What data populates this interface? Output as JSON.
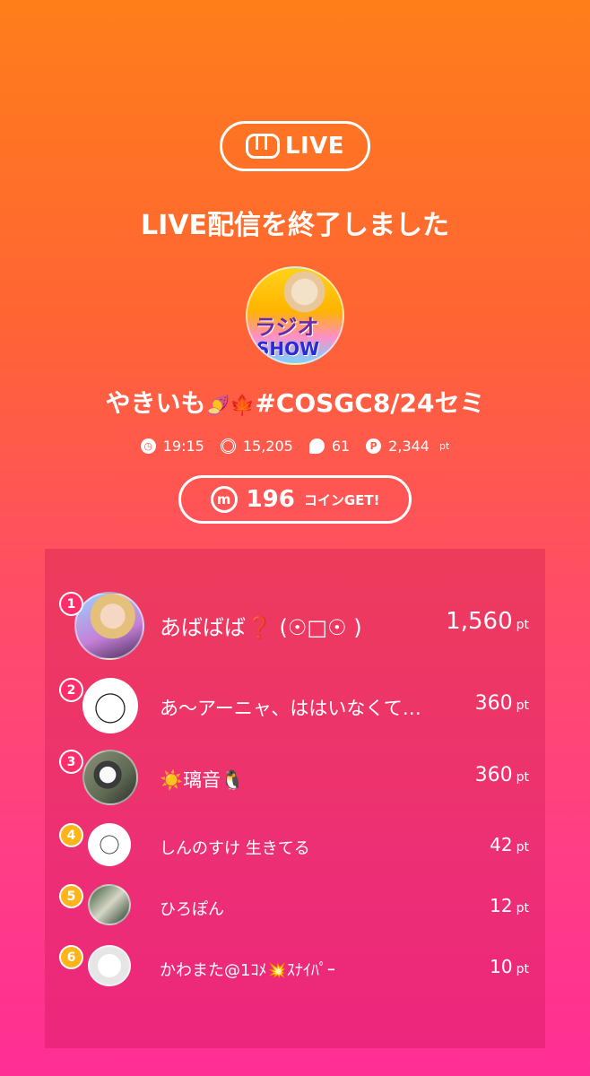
{
  "header": {
    "logo_text": "LIVE",
    "title": "LIVE配信を終了しました"
  },
  "live": {
    "avatar_text_1": "ラジオ",
    "avatar_text_2": "SHOW",
    "name_prefix": "やきいも",
    "name_emoji_1": "🍠",
    "name_emoji_2": "🍁",
    "name_suffix": "#COSGC8/24セミ"
  },
  "stats": {
    "duration": "19:15",
    "views": "15,205",
    "comments": "61",
    "points": "2,344",
    "points_unit": "pt"
  },
  "coin": {
    "amount": "196",
    "label": "コインGET!"
  },
  "ranking": [
    {
      "rank": "1",
      "name": "あばばば❓ (☉□☉ )",
      "points": "1,560",
      "unit": "pt"
    },
    {
      "rank": "2",
      "name": "あ〜アーニャ、ははいなくて…",
      "points": "360",
      "unit": "pt"
    },
    {
      "rank": "3",
      "name": "☀️璃音🐧",
      "points": "360",
      "unit": "pt"
    },
    {
      "rank": "4",
      "name": "しんのすけ 生きてる",
      "points": "42",
      "unit": "pt"
    },
    {
      "rank": "5",
      "name": "ひろぽん",
      "points": "12",
      "unit": "pt"
    },
    {
      "rank": "6",
      "name": "かわまた@1ｺﾒ💥ｽﾅｲﾊﾟｰ",
      "points": "10",
      "unit": "pt"
    }
  ],
  "colors": {
    "gradient_top": "#ff7e1a",
    "gradient_bottom": "#ff2e94",
    "badge_top3": "#ff2d6a",
    "badge_other": "#ffb41a"
  }
}
